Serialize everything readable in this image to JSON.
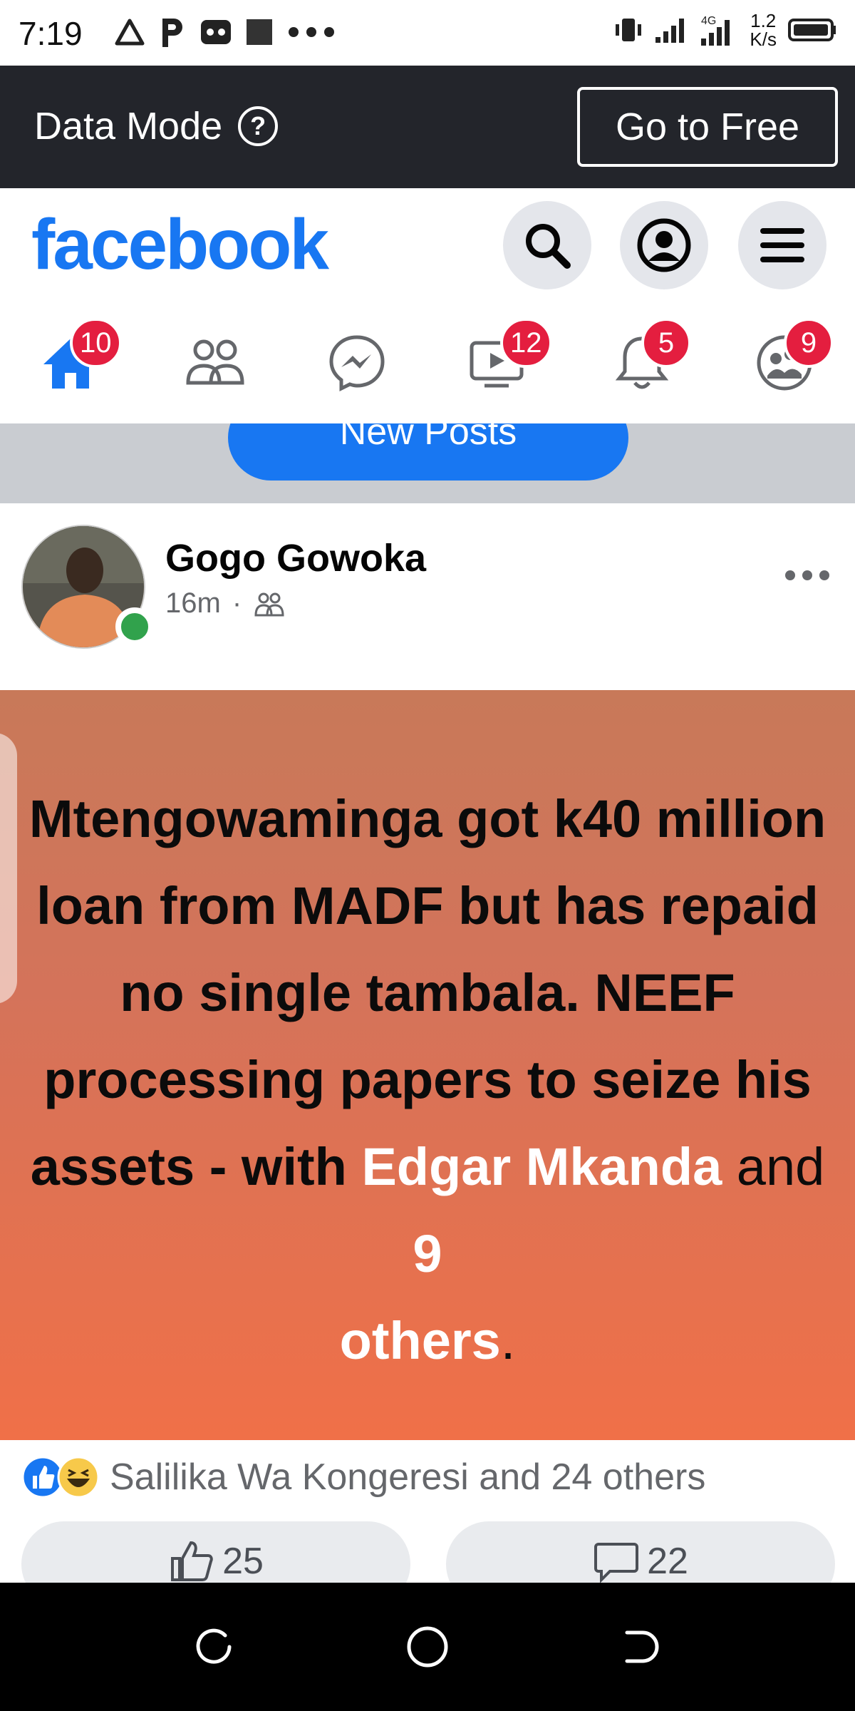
{
  "status_bar": {
    "time": "7:19",
    "network_type": "4G",
    "speed_value": "1.2",
    "speed_unit": "K/s"
  },
  "data_mode": {
    "label": "Data Mode",
    "help_icon": "?",
    "go_free_label": "Go to Free"
  },
  "header": {
    "logo": "facebook",
    "search_icon": "search-icon",
    "profile_icon": "profile-icon",
    "menu_icon": "menu-icon"
  },
  "nav": {
    "items": [
      {
        "name": "home",
        "badge": "10",
        "active": true
      },
      {
        "name": "friends",
        "badge": ""
      },
      {
        "name": "messenger",
        "badge": ""
      },
      {
        "name": "watch",
        "badge": "12"
      },
      {
        "name": "notifications",
        "badge": "5"
      },
      {
        "name": "groups",
        "badge": "9"
      }
    ]
  },
  "feed": {
    "new_posts_label": "New Posts"
  },
  "post": {
    "author": "Gogo Gowoka",
    "time": "16m",
    "separator": "·",
    "body_main": "Mtengowaminga got k40 million  loan from MADF but has repaid  no single tambala. NEEF processing papers  to seize his assets - with ",
    "tag_name": "Edgar Mkanda",
    "and_text": " and ",
    "others_count": "9",
    "others_word": "others",
    "end_period": ".",
    "reactions_text": "Salilika Wa Kongeresi and 24 others",
    "like_count": "25",
    "comment_count": "22"
  },
  "colors": {
    "brand": "#1877f2",
    "badge": "#e41e3f",
    "banner_top": "#c87959",
    "banner_bottom": "#f07048",
    "online": "#31a24c"
  }
}
